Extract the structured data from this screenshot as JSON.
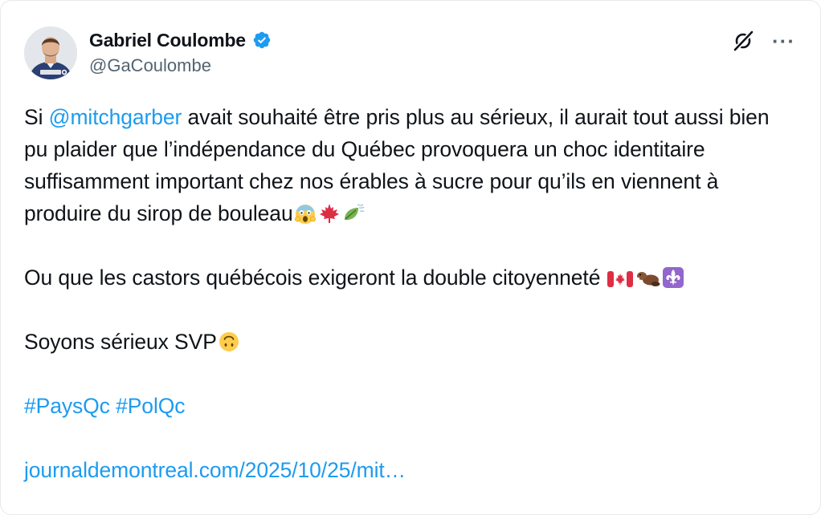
{
  "author": {
    "display_name": "Gabriel Coulombe",
    "handle": "@GaCoulombe",
    "verified": true,
    "avatar_shirt_text": "Gabriel Coulombe"
  },
  "actions": {
    "grok_icon": "grok-icon",
    "more_icon": "more-icon",
    "more_label": "···"
  },
  "tweet": {
    "p1_before": "Si ",
    "p1_mention": "@mitchgarber",
    "p1_text": " avait souhaité être pris plus au sérieux, il aurait tout aussi bien pu plaider que l’indépendance du Québec provoquera un choc identitaire suffisamment important chez nos érables à sucre pour qu’ils en viennent à produire du sirop de bouleau",
    "p1_emojis": [
      "face-screaming-in-fear",
      "maple-leaf",
      "leaf-fluttering-in-wind"
    ],
    "p2_text": "Ou que les castors québécois exigeront la double citoyenneté ",
    "p2_emojis": [
      "canada-flag",
      "beaver",
      "fleur-de-lis"
    ],
    "p3_text": "Soyons sérieux SVP",
    "p3_emojis": [
      "upside-down-face"
    ],
    "hashtag_1": "#PaysQc",
    "hashtag_2": "#PolQc",
    "link": "journaldemontreal.com/2025/10/25/mit…"
  },
  "colors": {
    "link": "#1d9bf0",
    "text": "#0f1419",
    "secondary": "#536471",
    "verified": "#1d9bf0"
  }
}
